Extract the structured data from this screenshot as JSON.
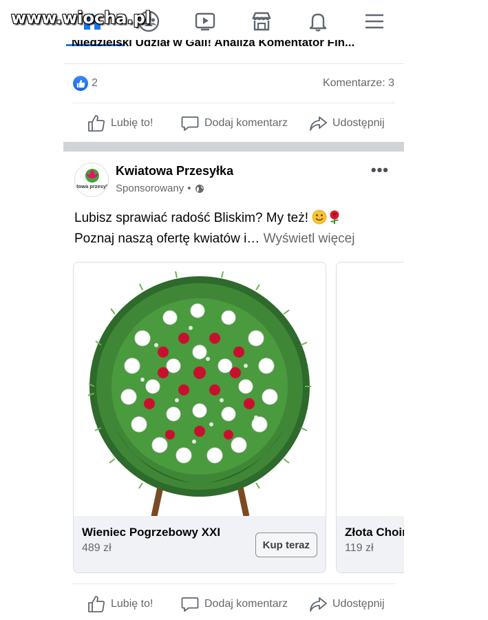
{
  "watermark": "www.wiocha.pl",
  "nav": {
    "items": [
      {
        "icon": "home-icon",
        "active": true
      },
      {
        "icon": "groups-icon"
      },
      {
        "icon": "watch-icon"
      },
      {
        "icon": "marketplace-icon"
      },
      {
        "icon": "bell-icon"
      },
      {
        "icon": "menu-icon"
      }
    ],
    "accent": "#1877f2"
  },
  "previous_post": {
    "title": "Niedzielski Udział w Gali! Analiza Komentator Fin...",
    "likes": "2",
    "comments": "Komentarze: 3"
  },
  "actions": {
    "like": "Lubię to!",
    "comment": "Dodaj komentarz",
    "share": "Udostępnij"
  },
  "ad_post": {
    "page_name": "Kwiatowa Przesyłka",
    "sponsored": "Sponsorowany",
    "dot": "•",
    "text_line1": "Lubisz sprawiać radość Bliskim? My też!",
    "text_line2": "Poznaj naszą ofertę kwiatów i…",
    "see_more": "Wyświetl więcej",
    "more_icon": "•••",
    "logo_text": "kwiatowa przesylka.pl",
    "cards": [
      {
        "title": "Wieniec Pogrzebowy XXI",
        "price": "489 zł",
        "cta": "Kup teraz"
      },
      {
        "title": "Złota Choinka",
        "price": "119 zł"
      }
    ]
  }
}
